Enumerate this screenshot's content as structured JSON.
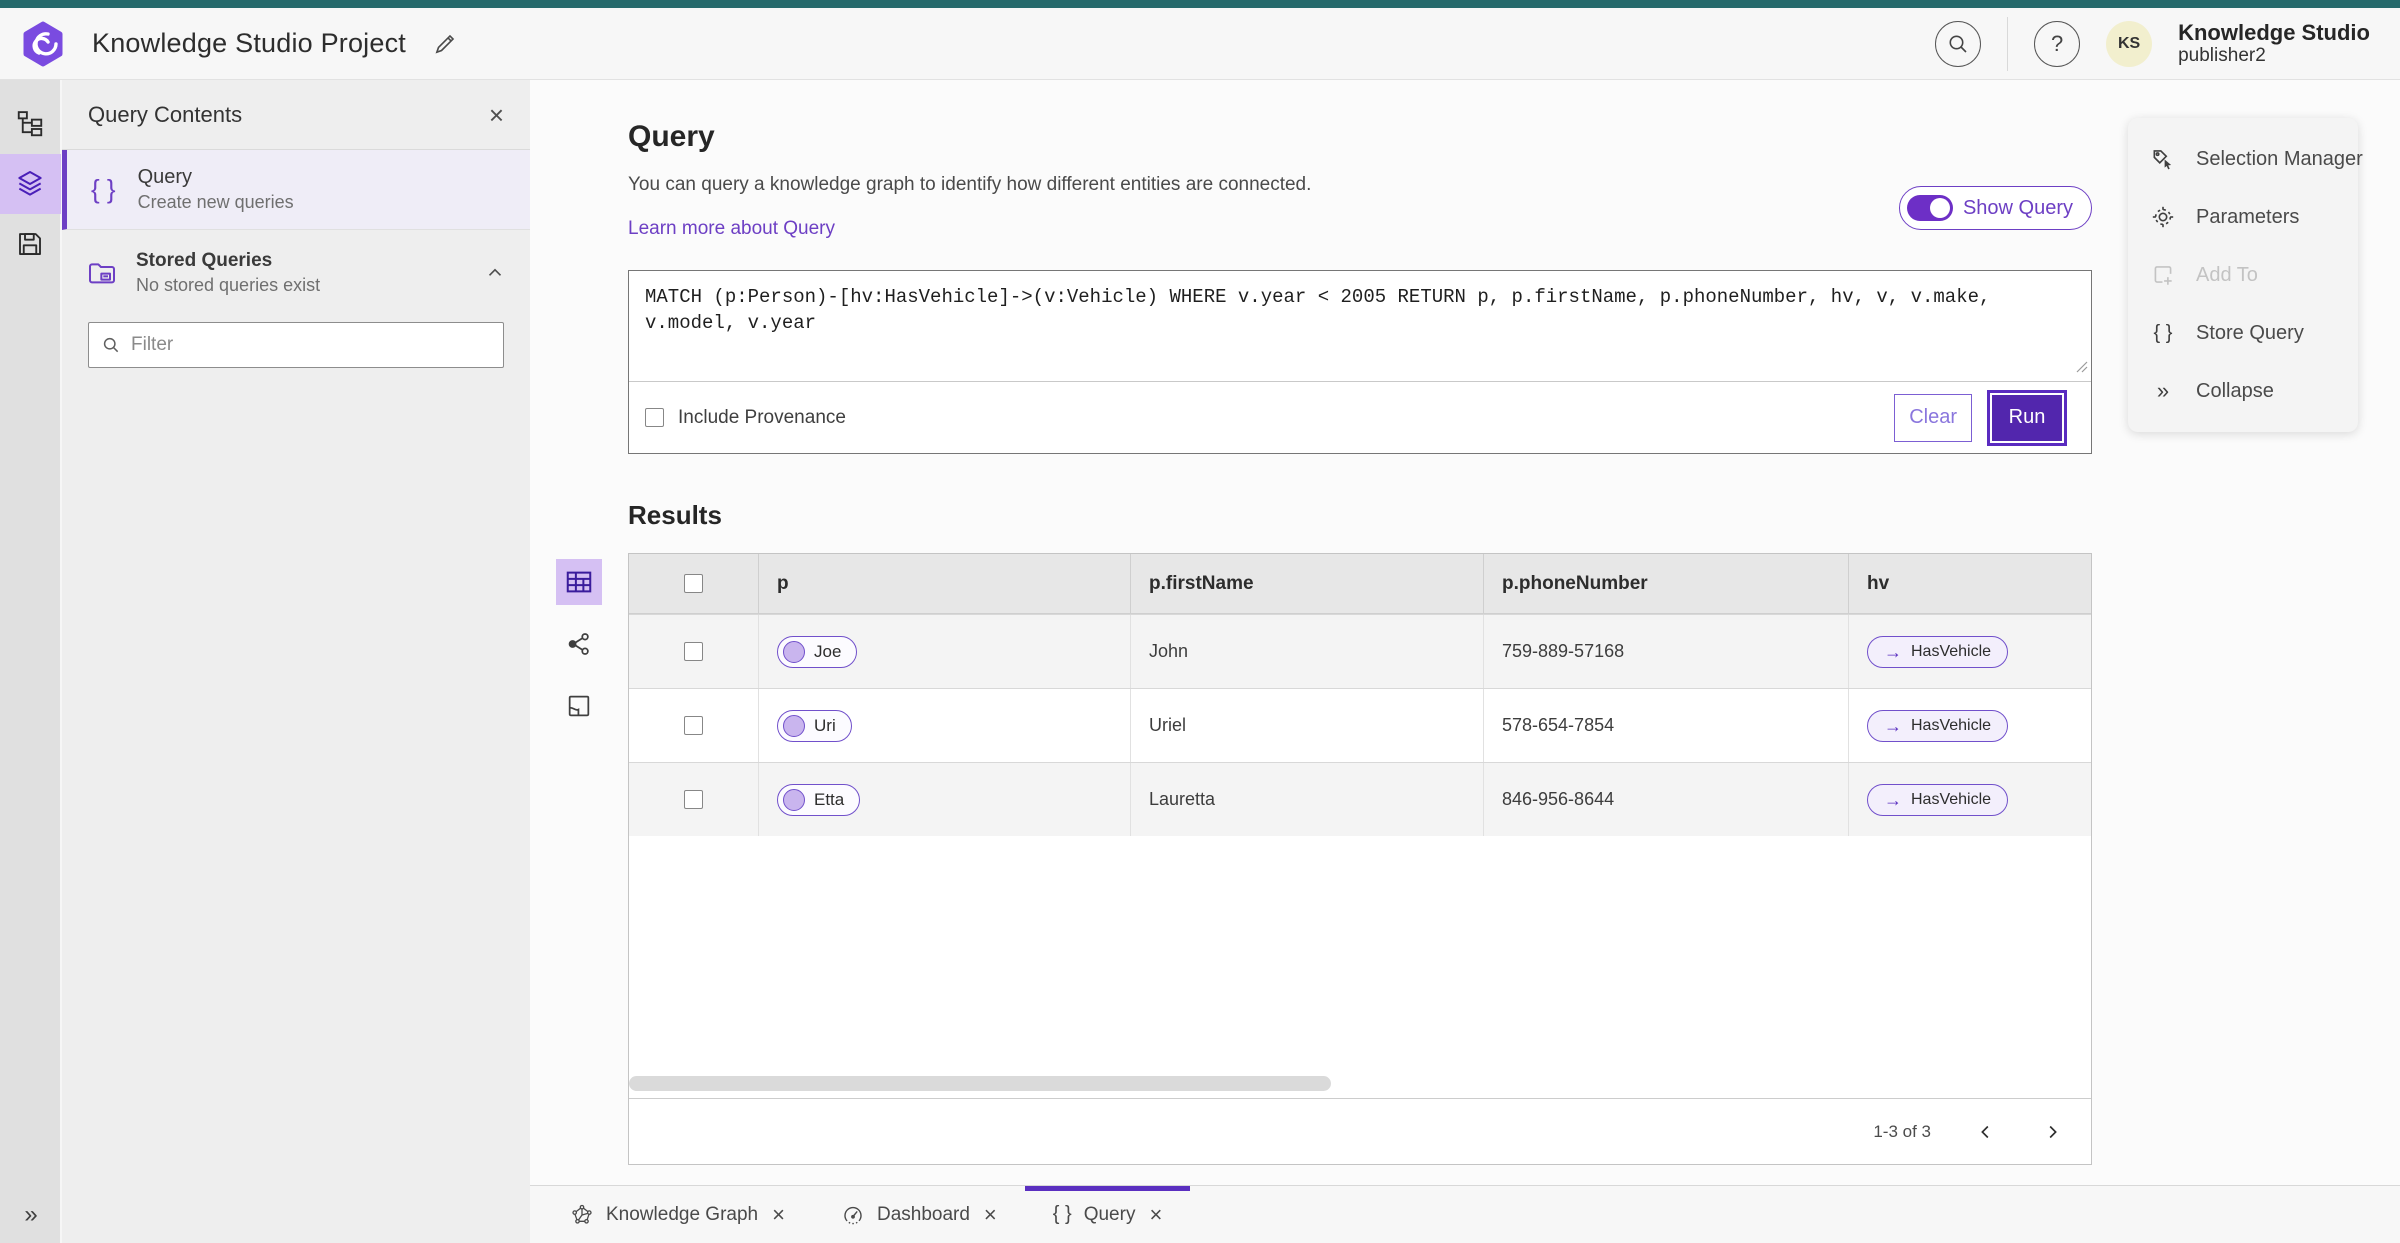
{
  "colors": {
    "accent_purple": "#6d3fc4",
    "accent_purple_dark": "#5226ad",
    "selected_lavender": "#d5c0f3",
    "top_strip_teal": "#266a6c",
    "avatar_bg": "#f2efce"
  },
  "icons": {
    "close": "×",
    "collapse_chevrons": "»",
    "braces": "{ }",
    "arrow_right": "→",
    "help": "?"
  },
  "header": {
    "title": "Knowledge Studio Project",
    "product_name": "Knowledge Studio",
    "user_name": "publisher2",
    "avatar_initials": "KS"
  },
  "query_contents": {
    "title": "Query Contents",
    "items": [
      {
        "title": "Query",
        "subtitle": "Create new queries"
      }
    ],
    "stored": {
      "title": "Stored Queries",
      "subtitle": "No stored queries exist"
    },
    "filter_placeholder": "Filter"
  },
  "query_panel": {
    "title": "Query",
    "description": "You can query a knowledge graph to identify how different entities are connected.",
    "learn_more": "Learn more about Query",
    "show_query_label": "Show Query",
    "query_text": "MATCH (p:Person)-[hv:HasVehicle]->(v:Vehicle) WHERE v.year < 2005 RETURN p, p.firstName, p.phoneNumber, hv, v, v.make, v.model, v.year",
    "include_provenance_label": "Include Provenance",
    "clear_label": "Clear",
    "run_label": "Run"
  },
  "results": {
    "title": "Results",
    "columns": [
      "p",
      "p.firstName",
      "p.phoneNumber",
      "hv"
    ],
    "rows": [
      {
        "p_label": "Joe",
        "firstName": "John",
        "phoneNumber": "759-889-57168",
        "hv_label": "HasVehicle"
      },
      {
        "p_label": "Uri",
        "firstName": "Uriel",
        "phoneNumber": "578-654-7854",
        "hv_label": "HasVehicle"
      },
      {
        "p_label": "Etta",
        "firstName": "Lauretta",
        "phoneNumber": "846-956-8644",
        "hv_label": "HasVehicle"
      }
    ],
    "pagination": "1-3 of 3"
  },
  "right_panel": {
    "items": [
      {
        "label": "Selection Manager"
      },
      {
        "label": "Parameters"
      },
      {
        "label": "Add To"
      },
      {
        "label": "Store Query"
      },
      {
        "label": "Collapse"
      }
    ]
  },
  "tabs": [
    {
      "label": "Knowledge Graph"
    },
    {
      "label": "Dashboard"
    },
    {
      "label": "Query"
    }
  ]
}
